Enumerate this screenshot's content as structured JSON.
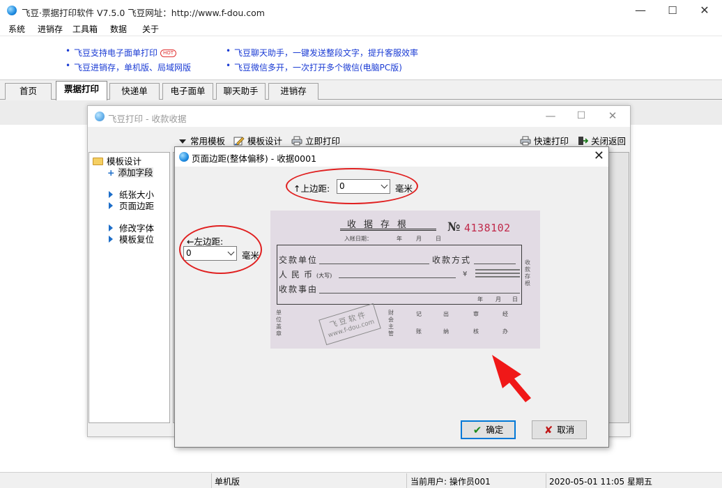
{
  "app": {
    "title": "飞豆·票据打印软件 V7.5.0   飞豆网址：http://www.f-dou.com",
    "window_controls": {
      "minimize": "—",
      "maximize": "☐",
      "close": "✕"
    }
  },
  "menu": [
    "系统",
    "进销存",
    "工具箱",
    "数据",
    "关于"
  ],
  "promo": {
    "left": [
      "飞豆支持电子面单打印",
      "飞豆进销存，单机版、局域网版"
    ],
    "right": [
      "飞豆聊天助手，一键发送整段文字，提升客服效率",
      "飞豆微信多开，一次打开多个微信(电脑PC版)"
    ],
    "hot_badge": "HOT"
  },
  "tabs": [
    "首页",
    "票据打印",
    "快递单",
    "电子面单",
    "聊天助手",
    "进销存"
  ],
  "active_tab": 1,
  "child_window": {
    "title": "飞豆打印 - 收款收据",
    "toolbar": {
      "common_templates": "常用模板",
      "template_design": "模板设计",
      "print_now": "立即打印",
      "quick_print": "快速打印",
      "close_return": "关闭返回"
    },
    "tree": {
      "root": "模板设计",
      "add_field": "添加字段",
      "paper_size": "纸张大小",
      "page_margin": "页面边距",
      "modify_font": "修改字体",
      "reset_template": "模板复位"
    }
  },
  "dialog": {
    "title": "页面边距(整体偏移) - 收据0001",
    "top_margin_label": "↑上边距:",
    "top_margin_value": "0",
    "left_margin_label": "←左边距:",
    "left_margin_value": "0",
    "unit": "毫米",
    "ok_button": "确定",
    "cancel_button": "取消"
  },
  "receipt": {
    "title": "收据存根",
    "no_label": "№",
    "number": "4138102",
    "entry_date": "入帐日期：",
    "year": "年",
    "month": "月",
    "day": "日",
    "row1_left": "交款单位",
    "row1_right": "收款方式",
    "row2": "人民币",
    "row2_small": "(大写)",
    "currency_sign": "¥",
    "row3": "收款事由",
    "side_right": "收款存根",
    "bottom_left": "单位盖章",
    "bottom_mid": "财会主管",
    "bottom_cols": [
      [
        "记",
        "账"
      ],
      [
        "出",
        "纳"
      ],
      [
        "审",
        "核"
      ],
      [
        "经",
        "办"
      ]
    ],
    "stamp_line1": "飞豆软件",
    "stamp_line2": "www.f-dou.com"
  },
  "status": {
    "edition": "单机版",
    "user": "当前用户: 操作员001",
    "datetime": "2020-05-01  11:05  星期五"
  },
  "colors": {
    "accent": "#0078d7",
    "annotation_red": "#e02020",
    "promo_link": "#1a3bd4",
    "receipt_number": "#c0294a"
  }
}
